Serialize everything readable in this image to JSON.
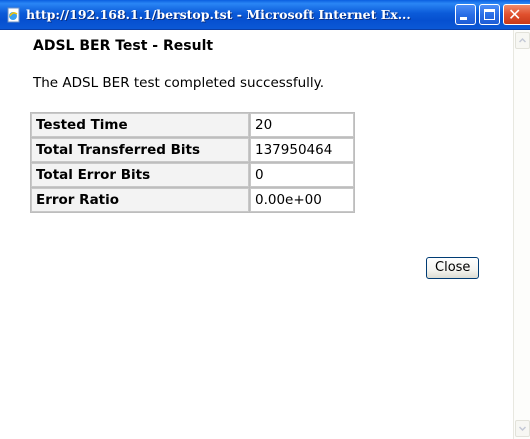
{
  "window": {
    "title": "http://192.168.1.1/berstop.tst - Microsoft Internet Ex...",
    "icon": "ie-page-icon",
    "buttons": {
      "minimize": "minimize-icon",
      "maximize": "maximize-icon",
      "close": "close-icon",
      "close_glyph": "✕"
    }
  },
  "page": {
    "heading": "ADSL BER Test - Result",
    "message": "The ADSL BER test completed successfully.",
    "table": [
      {
        "label": "Tested Time",
        "value": "20"
      },
      {
        "label": "Total Transferred Bits",
        "value": "137950464"
      },
      {
        "label": "Total Error Bits",
        "value": "0"
      },
      {
        "label": "Error Ratio",
        "value": "0.00e+00"
      }
    ],
    "close_button": "Close"
  },
  "colors": {
    "titlebar": "#0b5bd9",
    "close_button_red": "#e0502d",
    "table_border": "#bdbdbd",
    "label_bg": "#f3f3f3"
  }
}
